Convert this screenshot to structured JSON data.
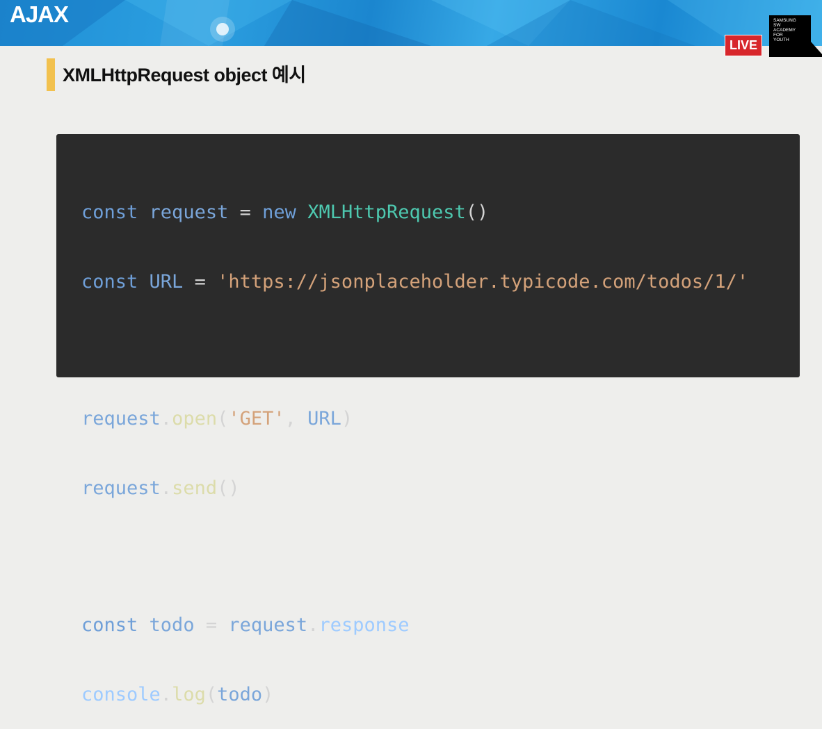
{
  "banner": {
    "title": "AJAX",
    "live": "LIVE",
    "logo_lines": [
      "SAMSUNG",
      "SW",
      "ACADEMY",
      "FOR",
      "YOUTH"
    ]
  },
  "slide": {
    "title": "XMLHttpRequest object 예시"
  },
  "code": {
    "l1": {
      "kw": "const",
      "var": "request",
      "op": "=",
      "kw2": "new",
      "cls": "XMLHttpRequest",
      "tail": "()"
    },
    "l2": {
      "kw": "const",
      "var": "URL",
      "op": "=",
      "str": "'https://jsonplaceholder.typicode.com/todos/1/'"
    },
    "l3": {
      "obj": "request",
      "dot": ".",
      "fn": "open",
      "open": "(",
      "str": "'GET'",
      "comma": ", ",
      "arg": "URL",
      "close": ")"
    },
    "l4": {
      "obj": "request",
      "dot": ".",
      "fn": "send",
      "tail": "()"
    },
    "l5": {
      "kw": "const",
      "var": "todo",
      "op": "=",
      "obj": "request",
      "dot": ".",
      "prop": "response"
    },
    "l6": {
      "obj": "console",
      "dot": ".",
      "fn": "log",
      "open": "(",
      "arg": "todo",
      "close": ")"
    }
  },
  "colors": {
    "banner": "#1f8fd6",
    "accent": "#f2c14e",
    "live": "#d7262b",
    "code_bg": "#2b2b2b"
  }
}
